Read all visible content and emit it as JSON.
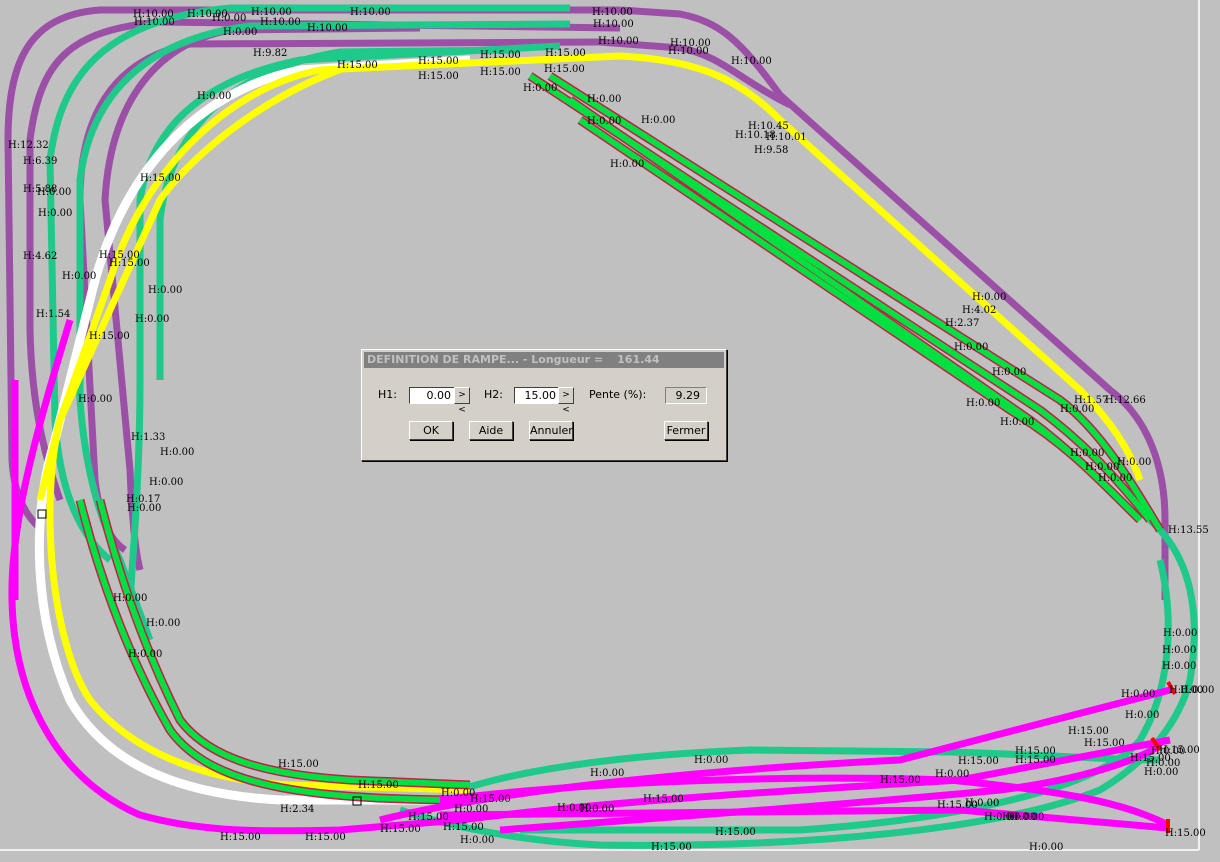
{
  "colors": {
    "background": "#c0c0c0",
    "track_purple": "#9b4fa6",
    "track_teal": "#1fc98a",
    "track_green": "#00e040",
    "track_green_border": "#c0204a",
    "track_yellow": "#ffff00",
    "track_white": "#ffffff",
    "track_magenta": "#ff00ff",
    "marker_red": "#ff0000"
  },
  "dialog": {
    "title": "DEFINITION DE RAMPE... - Longueur =",
    "length": "161.44",
    "h1_label": "H1:",
    "h1_value": "0.00",
    "h2_label": "H2:",
    "h2_value": "15.00",
    "swap_label": "><",
    "slope_label": "Pente (%):",
    "slope_value": "9.29",
    "ok_label": "OK",
    "help_label": "Aide",
    "cancel_label": "Annuler",
    "close_label": "Fermer"
  },
  "height_labels": [
    "H:10.00",
    "H:10.00",
    "H:10.00",
    "H:0.00",
    "H:10.00",
    "H:10.00",
    "H:10.00",
    "H:10.00",
    "H:10.00",
    "H:10.00",
    "H:10.00",
    "H:10.00",
    "H:10.00",
    "H:10.00",
    "H:0.00",
    "H:9.82",
    "H:15.00",
    "H:15.00",
    "H:15.00",
    "H:15.00",
    "H:15.00",
    "H:15.00",
    "H:15.00",
    "H:0.00",
    "H:0.00",
    "H:0.00",
    "H:0.00",
    "H:0.00",
    "H:10.45",
    "H:10.18",
    "H:10.01",
    "H:9.58",
    "H:12.32",
    "H:6.39",
    "H:5.88",
    "H:0.00",
    "H:0.00",
    "H:15.00",
    "H:0.00",
    "H:4.62",
    "H:15.00",
    "H:15.00",
    "H:0.00",
    "H:0.00",
    "H:0.00",
    "H:1.54",
    "H:15.00",
    "H:0.00",
    "H:1.33",
    "H:0.00",
    "H:0.00",
    "H:0.17",
    "H:0.00",
    "H:0.00",
    "H:0.00",
    "H:0.00",
    "H:0.00",
    "H:4.02",
    "H:2.37",
    "H:0.00",
    "H:0.00",
    "H:0.00",
    "H:0.00",
    "H:0.00",
    "H:1.57",
    "H:12.66",
    "H:0.00",
    "H:0.00",
    "H:0.00",
    "H:0.00",
    "H:0.00",
    "H:13.55",
    "H:0.00",
    "H:0.00",
    "H:0.00",
    "H:0.00",
    "H:0.00",
    "H:15.00",
    "H:15.00",
    "H:0.00",
    "H:15.00",
    "H:0.00",
    "H:0.00",
    "H:15.00",
    "H:15.00",
    "H:0.00",
    "H:15.00",
    "H:15.00",
    "H:0.00",
    "H:0.00",
    "H:0.00",
    "H:15.00",
    "H:2.34",
    "H:15.00",
    "H:15.00",
    "H:15.00",
    "H:15.00",
    "H:15.00",
    "H:0.00",
    "H:0.00",
    "H:15.00",
    "H:15.00",
    "H:0.00",
    "H:15.00",
    "H:0.00",
    "H:0.00",
    "H:15.00",
    "H:0.00",
    "H:0.00",
    "H:15.00",
    "H:15.00",
    "H:0.00",
    "H:15.00",
    "H:0.00",
    "H:0.00",
    "H:15.00"
  ]
}
